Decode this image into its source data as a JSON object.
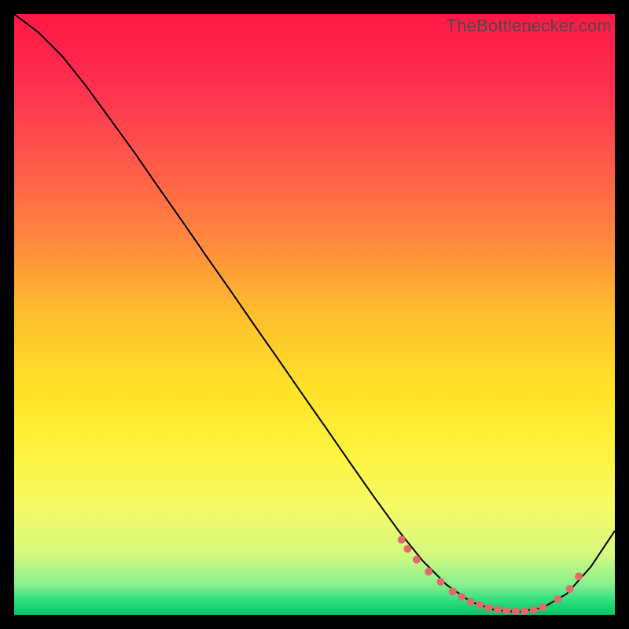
{
  "watermark": "TheBottlenecker.com",
  "chart_data": {
    "type": "line",
    "title": "",
    "xlabel": "",
    "ylabel": "",
    "xlim": [
      0,
      100
    ],
    "ylim": [
      0,
      100
    ],
    "series": [
      {
        "name": "curve",
        "color": "#000000",
        "x": [
          0,
          4,
          8,
          12,
          16,
          20,
          24,
          28,
          32,
          36,
          40,
          44,
          48,
          52,
          56,
          60,
          64,
          68,
          72,
          76,
          80,
          84,
          88,
          92,
          96,
          100
        ],
        "y": [
          100,
          97,
          93,
          88,
          82.5,
          77,
          71.2,
          65.5,
          59.7,
          54,
          48.2,
          42.5,
          36.7,
          31,
          25.2,
          19.5,
          14,
          9,
          5,
          2.2,
          0.8,
          0.5,
          1.2,
          3.5,
          8,
          14
        ]
      }
    ],
    "markers": {
      "name": "dots",
      "color": "#e26a6a",
      "radius": 5,
      "x": [
        64.5,
        65.5,
        67,
        69,
        71,
        73,
        74.5,
        76,
        77.5,
        79,
        80.5,
        82,
        83.5,
        85,
        86.5,
        88,
        90.5,
        92.5,
        94
      ],
      "y": [
        12.5,
        11,
        9.2,
        7.2,
        5.5,
        3.9,
        3.0,
        2.2,
        1.6,
        1.2,
        0.9,
        0.7,
        0.6,
        0.6,
        0.8,
        1.3,
        2.6,
        4.3,
        6.4
      ]
    },
    "background_gradient": {
      "stops": [
        {
          "offset": 0.0,
          "color": "#ff1846"
        },
        {
          "offset": 0.12,
          "color": "#ff3050"
        },
        {
          "offset": 0.25,
          "color": "#ff5a4a"
        },
        {
          "offset": 0.38,
          "color": "#ff8a3e"
        },
        {
          "offset": 0.5,
          "color": "#ffbf2e"
        },
        {
          "offset": 0.62,
          "color": "#ffe128"
        },
        {
          "offset": 0.72,
          "color": "#fff23a"
        },
        {
          "offset": 0.82,
          "color": "#f7fb66"
        },
        {
          "offset": 0.9,
          "color": "#d4f97f"
        },
        {
          "offset": 0.95,
          "color": "#88ef8e"
        },
        {
          "offset": 0.975,
          "color": "#30e080"
        },
        {
          "offset": 1.0,
          "color": "#05c565"
        }
      ]
    }
  }
}
